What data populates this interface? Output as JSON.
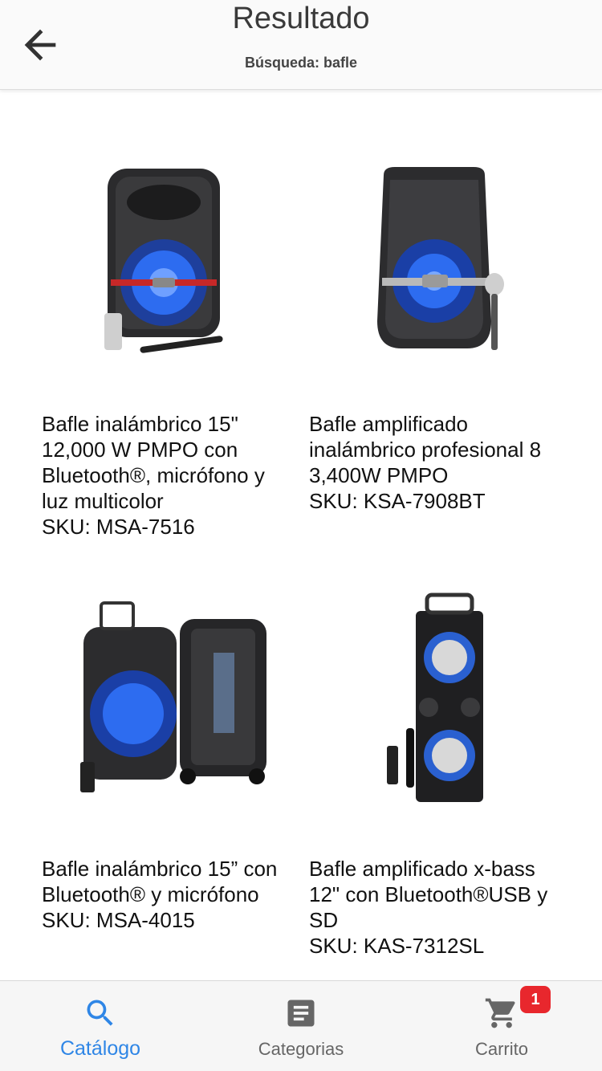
{
  "header": {
    "title": "Resultado",
    "subtitle": "Búsqueda: bafle"
  },
  "products": [
    {
      "name": "Bafle inalámbrico 15\" 12,000 W PMPO con Bluetooth®, micrófono y luz multicolor",
      "sku": "SKU: MSA-7516"
    },
    {
      "name": "Bafle amplificado inalámbrico profesional 8     3,400W PMPO",
      "sku": "SKU: KSA-7908BT"
    },
    {
      "name": "Bafle inalámbrico 15” con Bluetooth® y micrófono",
      "sku": "SKU: MSA-4015"
    },
    {
      "name": "Bafle amplificado x-bass 12\" con Bluetooth®USB y SD",
      "sku": "SKU: KAS-7312SL"
    }
  ],
  "tabs": [
    {
      "label": "Catálogo",
      "icon": "search-icon",
      "active": true
    },
    {
      "label": "Categorias",
      "icon": "list-icon",
      "active": false
    },
    {
      "label": "Carrito",
      "icon": "cart-icon",
      "active": false
    }
  ],
  "cart_badge": "1",
  "colors": {
    "accent": "#2f86e6",
    "badge": "#e8272d",
    "speaker_glow": "#2d6cf0"
  }
}
